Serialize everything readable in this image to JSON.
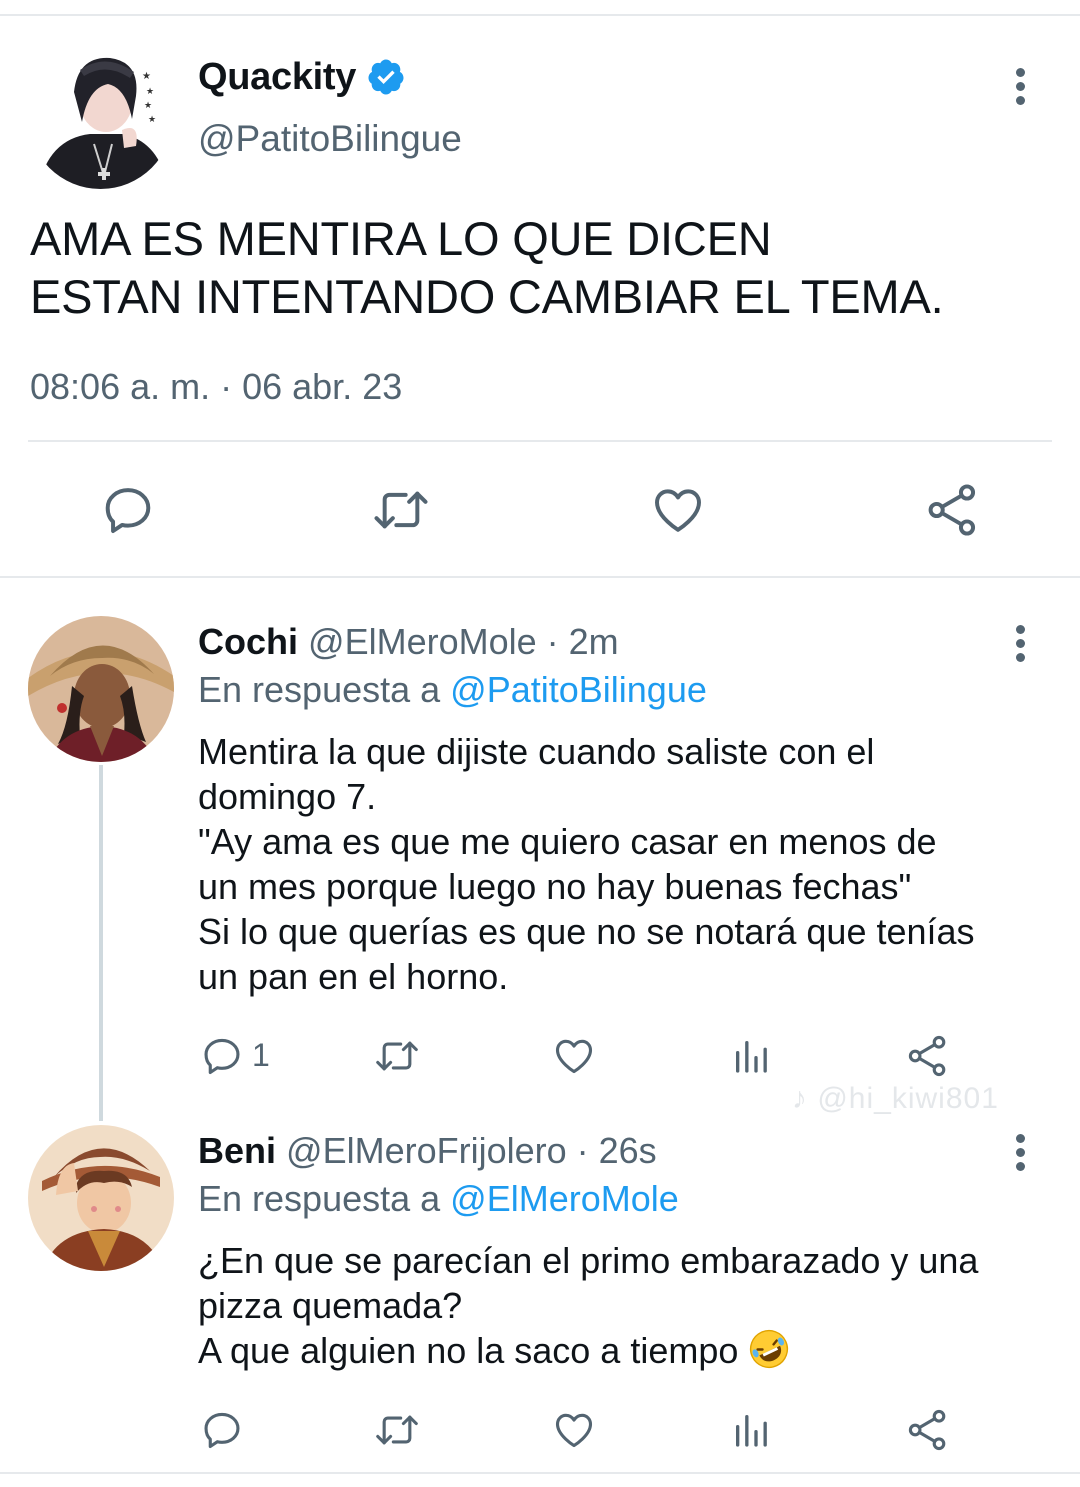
{
  "main_tweet": {
    "name": "Quackity",
    "handle": "@PatitoBilingue",
    "text_line1": "AMA ES MENTIRA LO QUE DICEN",
    "text_line2": "ESTAN INTENTANDO CAMBIAR EL TEMA.",
    "timestamp": "08:06 a. m. · 06 abr. 23",
    "actions": [
      "reply-icon",
      "retweet-icon",
      "like-icon",
      "share-icon"
    ]
  },
  "replies": [
    {
      "name": "Cochi",
      "handle": "@ElMeroMole · 2m",
      "reply_prefix": "En respuesta a ",
      "reply_to": "@PatitoBilingue",
      "lines": [
        "Mentira la que dijiste cuando saliste con el",
        "domingo 7.",
        "\"Ay ama es que me quiero casar en menos de",
        "un mes porque luego no hay buenas fechas\"",
        "Si lo que querías es que no se notará que tenías",
        "un pan en el horno."
      ],
      "reply_count": "1"
    },
    {
      "name": "Beni",
      "handle": "@ElMeroFrijolero · 26s",
      "reply_prefix": "En respuesta a ",
      "reply_to": "@ElMeroMole",
      "lines": [
        "¿En que se parecían el primo embarazado y una",
        "pizza quemada?",
        "A que alguien no la saco a tiempo"
      ],
      "emoji": "rolling-on-floor-laughing"
    }
  ],
  "watermark": "♪ @hi_kiwi801",
  "colors": {
    "text": "#0f1419",
    "secondary": "#536471",
    "link": "#1d9bf0",
    "divider": "#e6e9ec"
  }
}
